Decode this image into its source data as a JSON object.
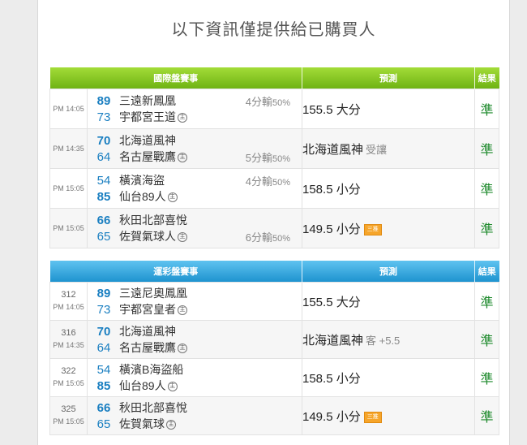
{
  "notice": "以下資訊僅提供給已購買人",
  "intl": {
    "headers": {
      "match": "國際盤賽事",
      "predict": "預測",
      "result": "結果"
    },
    "rows": [
      {
        "time": "PM 14:05",
        "a_score": "89",
        "a_team": "三遠新鳳凰",
        "a_home": false,
        "b_score": "73",
        "b_team": "宇都宮王道",
        "b_home": true,
        "hcap_pos": "a",
        "hcap": "4分輸",
        "hcap_pct": "50%",
        "pred": "155.5 大分",
        "pred_sub": "",
        "tag": false,
        "result": "準"
      },
      {
        "time": "PM 14:35",
        "a_score": "70",
        "a_team": "北海道風神",
        "a_home": false,
        "b_score": "64",
        "b_team": "名古屋戰鷹",
        "b_home": true,
        "hcap_pos": "b",
        "hcap": "5分輸",
        "hcap_pct": "50%",
        "pred": "北海道風神",
        "pred_sub": "受讓",
        "tag": false,
        "result": "準"
      },
      {
        "time": "PM 15:05",
        "a_score": "54",
        "a_team": "橫濱海盜",
        "a_home": false,
        "b_score": "85",
        "b_team": "仙台89人",
        "b_home": true,
        "hcap_pos": "a",
        "hcap": "4分輸",
        "hcap_pct": "50%",
        "pred": "158.5 小分",
        "pred_sub": "",
        "tag": false,
        "result": "準"
      },
      {
        "time": "PM 15:05",
        "a_score": "66",
        "a_team": "秋田北部喜悅",
        "a_home": false,
        "b_score": "65",
        "b_team": "佐賀氣球人",
        "b_home": true,
        "hcap_pos": "b",
        "hcap": "6分輸",
        "hcap_pct": "50%",
        "pred": "149.5 小分",
        "pred_sub": "",
        "tag": true,
        "result": "準"
      }
    ]
  },
  "lottery": {
    "headers": {
      "match": "運彩盤賽事",
      "predict": "預測",
      "result": "結果"
    },
    "rows": [
      {
        "num": "312",
        "time": "PM 14:05",
        "a_score": "89",
        "a_team": "三遠尼奧鳳凰",
        "a_home": false,
        "b_score": "73",
        "b_team": "宇都宮皇者",
        "b_home": true,
        "pred": "155.5 大分",
        "pred_sub": "",
        "tag": false,
        "result": "準"
      },
      {
        "num": "316",
        "time": "PM 14:35",
        "a_score": "70",
        "a_team": "北海道風神",
        "a_home": false,
        "b_score": "64",
        "b_team": "名古屋戰鷹",
        "b_home": true,
        "pred": "北海道風神",
        "pred_sub": "客 +5.5",
        "tag": false,
        "result": "準"
      },
      {
        "num": "322",
        "time": "PM 15:05",
        "a_score": "54",
        "a_team": "橫濱B海盜船",
        "a_home": false,
        "b_score": "85",
        "b_team": "仙台89人",
        "b_home": true,
        "pred": "158.5 小分",
        "pred_sub": "",
        "tag": false,
        "result": "準"
      },
      {
        "num": "325",
        "time": "PM 15:05",
        "a_score": "66",
        "a_team": "秋田北部喜悅",
        "a_home": false,
        "b_score": "65",
        "b_team": "佐賀氣球",
        "b_home": true,
        "pred": "149.5 小分",
        "pred_sub": "",
        "tag": true,
        "result": "準"
      }
    ]
  },
  "home_mark": "主",
  "tag_label": "三推"
}
